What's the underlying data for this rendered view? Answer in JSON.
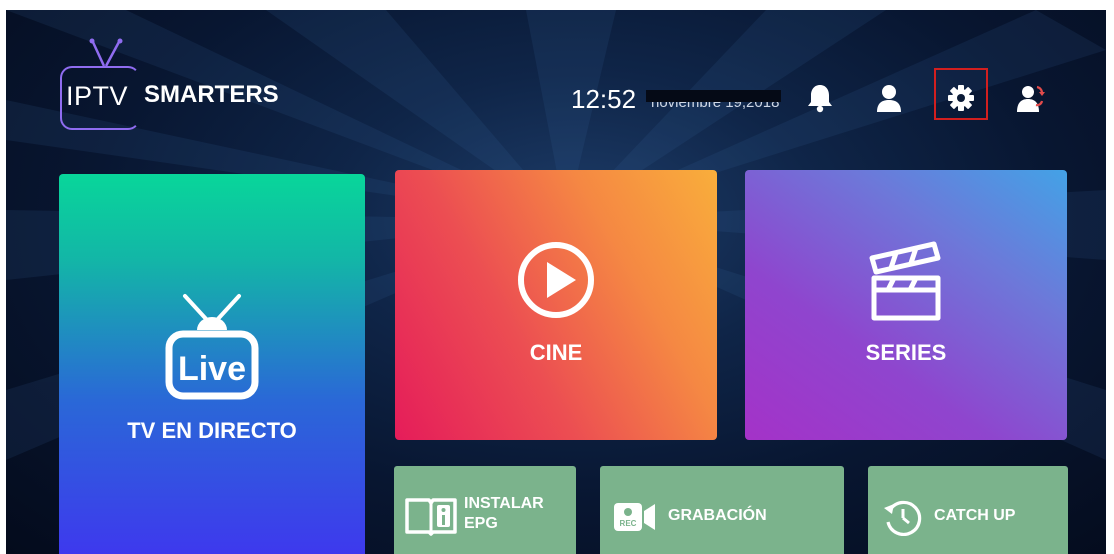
{
  "brand": {
    "logo_part1": "IPTV",
    "logo_part2": "SMARTERS"
  },
  "header": {
    "time": "12:52",
    "date": "noviembre 19,2018",
    "icons": [
      "bell-icon",
      "user-icon",
      "settings-icon",
      "switch-user-icon"
    ],
    "highlighted_icon": "settings-icon",
    "highlight_color": "#d21f1f"
  },
  "tiles": {
    "live": {
      "badge": "Live",
      "label": "TV EN DIRECTO",
      "icon": "tv-live-icon"
    },
    "cine": {
      "label": "CINE",
      "icon": "play-circle-icon"
    },
    "series": {
      "label": "SERIES",
      "icon": "clapperboard-icon"
    }
  },
  "actions": {
    "epg": {
      "line1": "INSTALAR",
      "line2": "EPG",
      "icon": "book-info-icon"
    },
    "rec": {
      "label": "GRABACIÓN",
      "icon": "rec-camera-icon"
    },
    "catchup": {
      "label": "CATCH UP",
      "icon": "history-icon"
    }
  },
  "colors": {
    "background": "#0a1a36",
    "live_top": "#08d69a",
    "live_bottom": "#3f36ef",
    "cine_start": "#e51c5a",
    "cine_end": "#f9ae3b",
    "series_start": "#a432c8",
    "series_end": "#43a2e6",
    "action_tile": "#7bb38c"
  }
}
